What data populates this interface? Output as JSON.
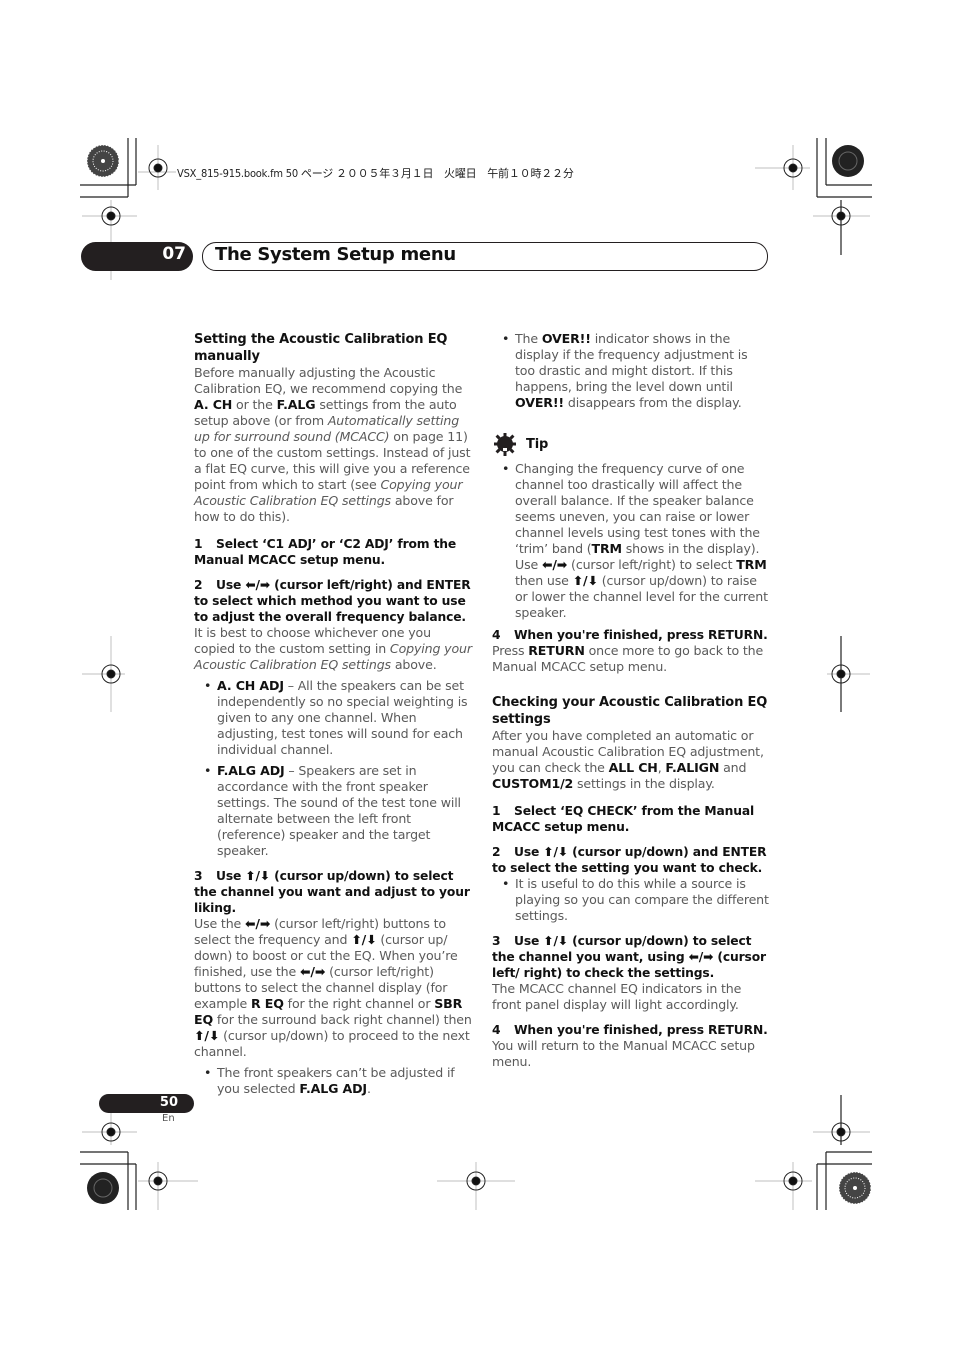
{
  "print_header": "VSX_815-915.book.fm  50 ページ  ２００５年３月１日　火曜日　午前１０時２２分",
  "chapter": {
    "number": "07",
    "title": "The System Setup menu"
  },
  "left_column": {
    "heading": "Setting the Acoustic Calibration EQ manually",
    "intro": [
      {
        "t": "Before manually adjusting the Acoustic Calibration EQ, we recommend copying the "
      },
      {
        "b": "A. CH"
      },
      {
        "t": " or the "
      },
      {
        "b": "F.ALG"
      },
      {
        "t": " settings from the auto setup above (or from "
      },
      {
        "i": "Automatically setting up for surround sound (MCACC)"
      },
      {
        "t": " on page 11) to one of the custom settings. Instead of just a flat EQ curve, this will give you a reference point from which to start (see "
      },
      {
        "i": "Copying your Acoustic Calibration EQ settings"
      },
      {
        "t": " above for how to do this)."
      }
    ],
    "step1": {
      "num": "1",
      "text": "Select ‘C1 ADJ’ or ‘C2 ADJ’ from the Manual MCACC setup menu."
    },
    "step2": {
      "num": "2",
      "text_before": "Use ",
      "arrows": "⬅/➡",
      "text_after": " (cursor left/right) and ENTER to select which method you want to use to adjust the overall frequency balance.",
      "body": [
        {
          "t": "It is best to choose whichever one you copied to the custom setting in "
        },
        {
          "i": "Copying your Acoustic Calibration EQ settings"
        },
        {
          "t": " above."
        }
      ],
      "bullets": [
        [
          {
            "b": "A. CH ADJ"
          },
          {
            "t": " – All the speakers can be set independently so no special weighting is given to any one channel. When adjusting, test tones will sound for each individual channel."
          }
        ],
        [
          {
            "b": "F.ALG ADJ"
          },
          {
            "t": " – Speakers are set in accordance with the front speaker settings. The sound of the test tone will alternate between the left front (reference) speaker and the target speaker."
          }
        ]
      ]
    },
    "step3": {
      "num": "3",
      "text_before": "Use ",
      "arrows": "⬆/⬇",
      "text_after": " (cursor up/down) to select the channel you want and adjust to your liking.",
      "body": [
        {
          "t": "Use the "
        },
        {
          "a": "⬅/➡"
        },
        {
          "t": " (cursor left/right) buttons to select the frequency and "
        },
        {
          "a": "⬆/⬇"
        },
        {
          "t": " (cursor up/ down) to boost or cut the EQ. When you’re finished, use the "
        },
        {
          "a": "⬅/➡"
        },
        {
          "t": " (cursor left/right) buttons to select the channel display (for example "
        },
        {
          "b": "R EQ"
        },
        {
          "t": " for the right channel or "
        },
        {
          "b": "SBR EQ"
        },
        {
          "t": " for the surround back right channel) then "
        },
        {
          "a": "⬆/⬇"
        },
        {
          "t": " (cursor up/down) to proceed to the next channel."
        }
      ],
      "bullets": [
        [
          {
            "t": "The front speakers can’t be adjusted if you selected "
          },
          {
            "b": "F.ALG ADJ"
          },
          {
            "t": "."
          }
        ]
      ]
    }
  },
  "right_column": {
    "over_bullet": [
      {
        "t": "The "
      },
      {
        "b": "OVER!!"
      },
      {
        "t": " indicator shows in the display if the frequency adjustment is too drastic and might distort. If this happens, bring the level down until "
      },
      {
        "b": "OVER!!"
      },
      {
        "t": " disappears from the display."
      }
    ],
    "tip": {
      "label": "Tip",
      "icon": "lightbulb-icon",
      "bullet": [
        {
          "t": "Changing the frequency curve of one channel too drastically will affect the overall balance. If the speaker balance seems uneven, you can raise or lower channel levels using test tones with the ‘trim’ band ("
        },
        {
          "b": "TRM"
        },
        {
          "t": " shows in the display). Use "
        },
        {
          "a": "⬅/➡"
        },
        {
          "t": " (cursor left/right) to select "
        },
        {
          "b": "TRM"
        },
        {
          "t": " then use "
        },
        {
          "a": "⬆/⬇"
        },
        {
          "t": " (cursor up/down) to raise or lower the channel level for the current speaker."
        }
      ]
    },
    "step4": {
      "num": "4",
      "text": "When you're finished, press RETURN.",
      "body": [
        {
          "t": "Press "
        },
        {
          "b": "RETURN"
        },
        {
          "t": " once more to go back to the Manual MCACC setup menu."
        }
      ]
    },
    "heading2": "Checking your Acoustic Calibration EQ settings",
    "intro2": [
      {
        "t": "After you have completed an automatic or manual Acoustic Calibration EQ adjustment, you can check the "
      },
      {
        "b": "ALL CH"
      },
      {
        "t": ", "
      },
      {
        "b": "F.ALIGN"
      },
      {
        "t": " and "
      },
      {
        "b": "CUSTOM1/2"
      },
      {
        "t": " settings in the display."
      }
    ],
    "c_step1": {
      "num": "1",
      "text": "Select ‘EQ CHECK’ from the Manual MCACC setup menu."
    },
    "c_step2": {
      "num": "2",
      "text_before": "Use ",
      "arrows": "⬆/⬇",
      "text_after": " (cursor up/down) and ENTER to select the setting you want to check.",
      "bullets": [
        [
          {
            "t": "It is useful to do this while a source is playing so you can compare the different settings."
          }
        ]
      ]
    },
    "c_step3": {
      "num": "3",
      "text_before": "Use ",
      "arrows": "⬆/⬇",
      "text_mid": " (cursor up/down) to select the channel you want, using ",
      "arrows2": "⬅/➡",
      "text_after": " (cursor left/ right) to check the settings.",
      "body": [
        {
          "t": "The MCACC channel EQ indicators in the front panel display will light accordingly."
        }
      ]
    },
    "c_step4": {
      "num": "4",
      "text": "When you're finished, press RETURN.",
      "body": [
        {
          "t": "You will return to the Manual MCACC setup menu."
        }
      ]
    }
  },
  "footer": {
    "page_number": "50",
    "language": "En"
  }
}
